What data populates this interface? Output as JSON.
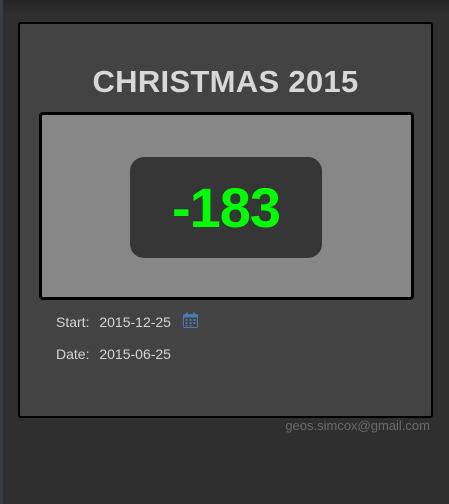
{
  "widget": {
    "title": "CHRISTMAS 2015",
    "counter": "-183",
    "start_label": "Start:",
    "start_value": "2015-12-25",
    "date_label": "Date:",
    "date_value": "2015-06-25",
    "calendar_icon": "calendar-icon"
  },
  "footer": {
    "email": "geos.simcox@gmail.com"
  },
  "colors": {
    "background": "#2f2f2f",
    "card": "#434343",
    "panel": "#878787",
    "counter_bg": "#363636",
    "counter_text": "#00ff00",
    "icon": "#4a78b5"
  }
}
